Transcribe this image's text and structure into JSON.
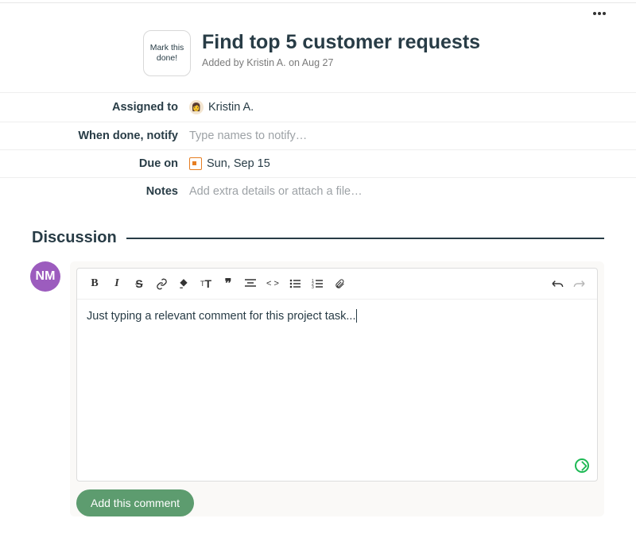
{
  "header": {
    "mark_done_label": "Mark this done!",
    "title": "Find top 5 customer requests",
    "added_by": "Added by Kristin A. on Aug 27"
  },
  "fields": {
    "assigned_to_label": "Assigned to",
    "assigned_to_value": "Kristin A.",
    "notify_label": "When done, notify",
    "notify_placeholder": "Type names to notify…",
    "due_label": "Due on",
    "due_value": "Sun, Sep 15",
    "notes_label": "Notes",
    "notes_placeholder": "Add extra details or attach a file…"
  },
  "discussion": {
    "title": "Discussion",
    "user_initials": "NM",
    "comment_text": "Just typing a relevant comment for this project task...",
    "submit_label": "Add this comment"
  },
  "toolbar": {
    "bold": "B",
    "italic": "I",
    "strike": "S",
    "heading": "T",
    "quote": "❝",
    "code": "< >"
  }
}
